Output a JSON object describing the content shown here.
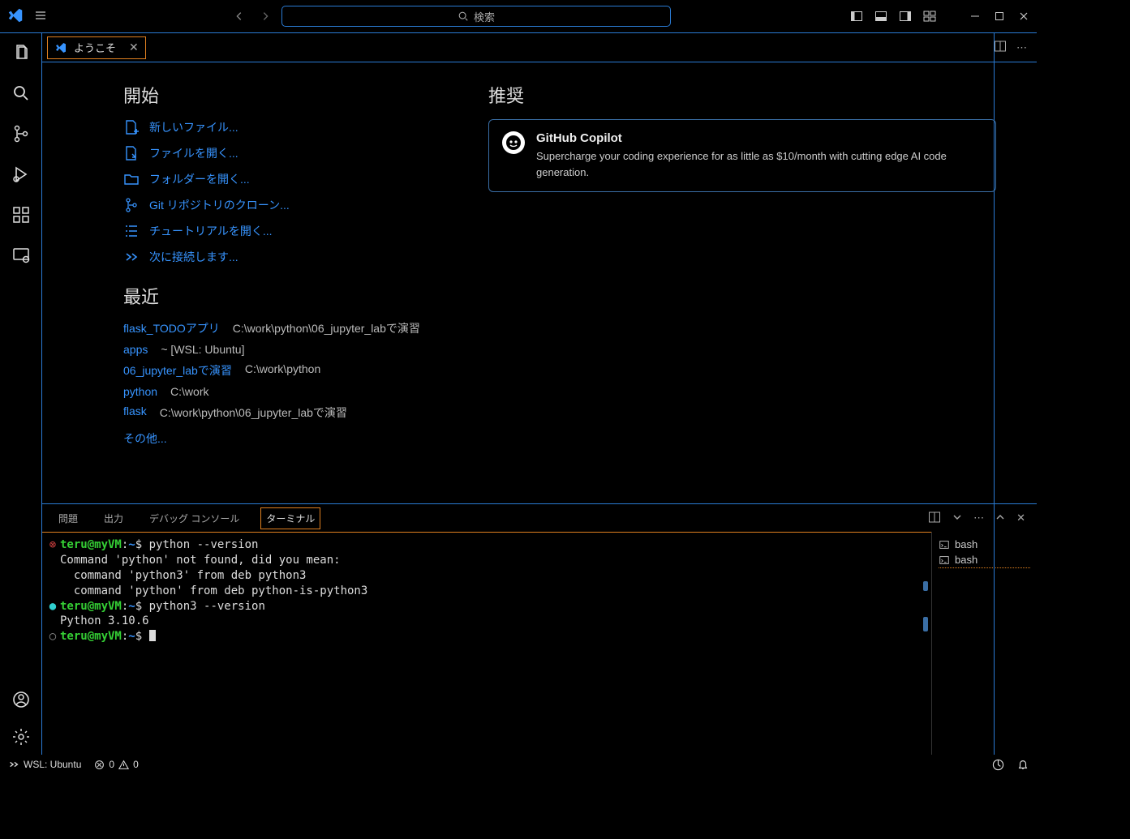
{
  "titlebar": {
    "search_placeholder": "検索"
  },
  "tab": {
    "welcome_label": "ようこそ"
  },
  "welcome": {
    "start_title": "開始",
    "start_items": [
      "新しいファイル...",
      "ファイルを開く...",
      "フォルダーを開く...",
      "Git リポジトリのクローン...",
      "チュートリアルを開く...",
      "次に接続します..."
    ],
    "recent_title": "最近",
    "recent": [
      {
        "name": "flask_TODOアプリ",
        "path": "C:\\work\\python\\06_jupyter_labで演習"
      },
      {
        "name": "apps",
        "path": "~ [WSL: Ubuntu]"
      },
      {
        "name": "06_jupyter_labで演習",
        "path": "C:\\work\\python"
      },
      {
        "name": "python",
        "path": "C:\\work"
      },
      {
        "name": "flask",
        "path": "C:\\work\\python\\06_jupyter_labで演習"
      }
    ],
    "more_label": "その他...",
    "recommend_title": "推奨",
    "copilot": {
      "title": "GitHub Copilot",
      "desc": "Supercharge your coding experience for as little as $10/month with cutting edge AI code generation."
    }
  },
  "panel": {
    "tabs": {
      "problems": "問題",
      "output": "出力",
      "debug": "デバッグ コンソール",
      "terminal": "ターミナル"
    }
  },
  "terminal": {
    "lines": [
      {
        "gutter": "⊗",
        "gclass": "dot-red",
        "user": "teru@myVM",
        "loc": "~",
        "cmd": "python --version"
      },
      {
        "out": "Command 'python' not found, did you mean:"
      },
      {
        "out": "  command 'python3' from deb python3"
      },
      {
        "out": "  command 'python' from deb python-is-python3"
      },
      {
        "gutter": "●",
        "gclass": "dot-cyan",
        "user": "teru@myVM",
        "loc": "~",
        "cmd": "python3 --version"
      },
      {
        "out": "Python 3.10.6"
      },
      {
        "gutter": "○",
        "gclass": "dot-gray",
        "user": "teru@myVM",
        "loc": "~",
        "cmd": "",
        "cursor": true
      }
    ],
    "shells": [
      "bash",
      "bash"
    ]
  },
  "statusbar": {
    "remote": "WSL: Ubuntu",
    "errors": "0",
    "warnings": "0"
  }
}
